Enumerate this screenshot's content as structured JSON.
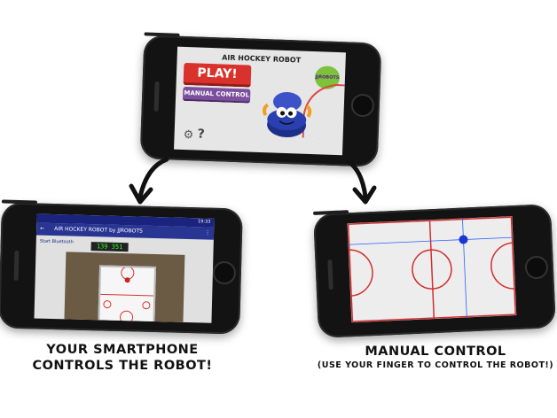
{
  "phone_top": {
    "app_title": "AIR HOCKEY ROBOT",
    "play_label": "PLAY!",
    "manual_label": "MANUAL CONTROL",
    "badge_text": "JJROBOTS",
    "settings_icon": "gear-icon",
    "help_icon": "question-icon"
  },
  "phone_left": {
    "status_time": "19:33",
    "app_title": "AIR HOCKEY ROBOT by JJROBOTS",
    "connect_text": "Start Bluetooth",
    "score": "139 351"
  },
  "captions": {
    "left": "YOUR SMARTPHONE CONTROLS THE ROBOT!",
    "right_title": "MANUAL CONTROL",
    "right_sub": "(USE YOUR FINGER TO CONTROL THE ROBOT!)"
  }
}
